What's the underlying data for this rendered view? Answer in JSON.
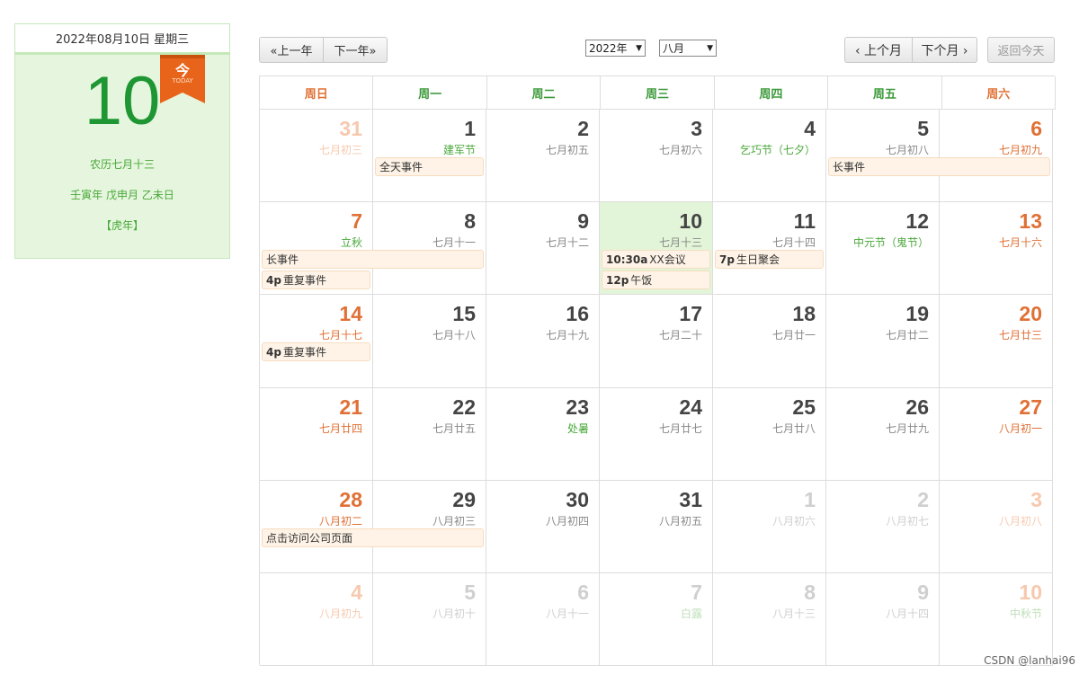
{
  "today_panel": {
    "header": "2022年08月10日 星期三",
    "day": "10",
    "badge_char": "今",
    "badge_text": "TODAY",
    "lunar": "农历七月十三",
    "ganzhi": "壬寅年 戊申月 乙未日",
    "zodiac": "【虎年】"
  },
  "toolbar": {
    "prev_year": "«上一年",
    "next_year": "下一年»",
    "year_select": "2022年",
    "month_select": "八月",
    "prev_month": "‹ 上个月",
    "next_month": "下个月 ›",
    "today_button": "返回今天"
  },
  "weekdays": [
    "周日",
    "周一",
    "周二",
    "周三",
    "周四",
    "周五",
    "周六"
  ],
  "weeks": [
    [
      {
        "d": "31",
        "l": "七月初三",
        "other": true
      },
      {
        "d": "1",
        "l": "建军节",
        "fest": true
      },
      {
        "d": "2",
        "l": "七月初五"
      },
      {
        "d": "3",
        "l": "七月初六"
      },
      {
        "d": "4",
        "l": "乞巧节（七夕）",
        "fest": true
      },
      {
        "d": "5",
        "l": "七月初八"
      },
      {
        "d": "6",
        "l": "七月初九"
      }
    ],
    [
      {
        "d": "7",
        "l": "立秋",
        "fest": true
      },
      {
        "d": "8",
        "l": "七月十一"
      },
      {
        "d": "9",
        "l": "七月十二"
      },
      {
        "d": "10",
        "l": "七月十三",
        "today": true
      },
      {
        "d": "11",
        "l": "七月十四"
      },
      {
        "d": "12",
        "l": "中元节（鬼节）",
        "fest": true
      },
      {
        "d": "13",
        "l": "七月十六"
      }
    ],
    [
      {
        "d": "14",
        "l": "七月十七"
      },
      {
        "d": "15",
        "l": "七月十八"
      },
      {
        "d": "16",
        "l": "七月十九"
      },
      {
        "d": "17",
        "l": "七月二十"
      },
      {
        "d": "18",
        "l": "七月廿一"
      },
      {
        "d": "19",
        "l": "七月廿二"
      },
      {
        "d": "20",
        "l": "七月廿三"
      }
    ],
    [
      {
        "d": "21",
        "l": "七月廿四"
      },
      {
        "d": "22",
        "l": "七月廿五"
      },
      {
        "d": "23",
        "l": "处暑",
        "fest": true
      },
      {
        "d": "24",
        "l": "七月廿七"
      },
      {
        "d": "25",
        "l": "七月廿八"
      },
      {
        "d": "26",
        "l": "七月廿九"
      },
      {
        "d": "27",
        "l": "八月初一"
      }
    ],
    [
      {
        "d": "28",
        "l": "八月初二"
      },
      {
        "d": "29",
        "l": "八月初三"
      },
      {
        "d": "30",
        "l": "八月初四"
      },
      {
        "d": "31",
        "l": "八月初五"
      },
      {
        "d": "1",
        "l": "八月初六",
        "other": true
      },
      {
        "d": "2",
        "l": "八月初七",
        "other": true
      },
      {
        "d": "3",
        "l": "八月初八",
        "other": true
      }
    ],
    [
      {
        "d": "4",
        "l": "八月初九",
        "other": true
      },
      {
        "d": "5",
        "l": "八月初十",
        "other": true
      },
      {
        "d": "6",
        "l": "八月十一",
        "other": true
      },
      {
        "d": "7",
        "l": "白露",
        "other": true,
        "fest": true
      },
      {
        "d": "8",
        "l": "八月十三",
        "other": true
      },
      {
        "d": "9",
        "l": "八月十四",
        "other": true
      },
      {
        "d": "10",
        "l": "中秋节",
        "other": true,
        "fest": true
      }
    ]
  ],
  "events": [
    {
      "week": 0,
      "col": 1,
      "span": 1,
      "row": 0,
      "time": "",
      "title": "全天事件"
    },
    {
      "week": 0,
      "col": 5,
      "span": 2,
      "row": 0,
      "time": "",
      "title": "长事件"
    },
    {
      "week": 1,
      "col": 0,
      "span": 2,
      "row": 0,
      "time": "",
      "title": "长事件"
    },
    {
      "week": 1,
      "col": 0,
      "span": 1,
      "row": 1,
      "time": "4p",
      "title": "重复事件"
    },
    {
      "week": 1,
      "col": 3,
      "span": 1,
      "row": 0,
      "time": "10:30a",
      "title": "XX会议"
    },
    {
      "week": 1,
      "col": 3,
      "span": 1,
      "row": 1,
      "time": "12p",
      "title": "午饭"
    },
    {
      "week": 1,
      "col": 4,
      "span": 1,
      "row": 0,
      "time": "7p",
      "title": "生日聚会"
    },
    {
      "week": 2,
      "col": 0,
      "span": 1,
      "row": 0,
      "time": "4p",
      "title": "重复事件"
    },
    {
      "week": 4,
      "col": 0,
      "span": 2,
      "row": 0,
      "time": "",
      "title": "点击访问公司页面"
    }
  ],
  "watermark": "CSDN @lanhai96"
}
